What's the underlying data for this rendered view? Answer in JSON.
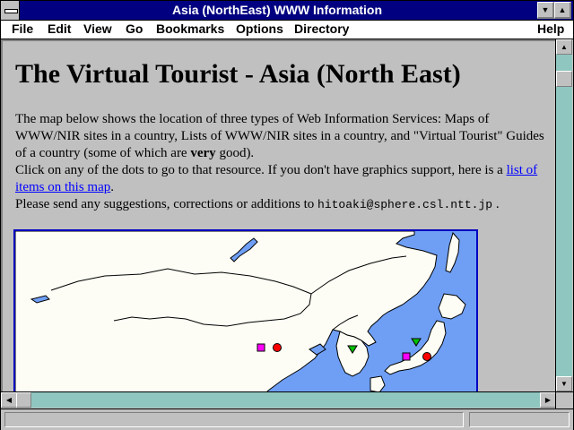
{
  "window": {
    "title": "Asia (NorthEast) WWW Information"
  },
  "menubar": {
    "file": "File",
    "edit": "Edit",
    "view": "View",
    "go": "Go",
    "bookmarks": "Bookmarks",
    "options": "Options",
    "directory": "Directory",
    "help": "Help"
  },
  "page": {
    "heading": "The Virtual Tourist - Asia (North East)",
    "intro_1": "The map below shows the location of three types of Web Information Services: Maps of WWW/NIR sites in a country, Lists of WWW/NIR sites in a country, and \"Virtual Tourist\" Guides of a country (some of which are ",
    "intro_bold": "very",
    "intro_2": " good).",
    "click_text": "Click on any of the dots to go to that resource. If you don't have graphics support, here is a ",
    "list_link": "list of items on this map",
    "list_after": ".",
    "send_text": "Please send any suggestions, corrections or additions to ",
    "email": "hitoaki@sphere.csl.ntt.jp",
    "send_after": " ."
  },
  "map": {
    "colors": {
      "sea": "#6f9ff5",
      "land": "#fdfdf5",
      "frame": "#0000c0",
      "map_marker": "#ff00ff",
      "list_marker": "#ff0000",
      "guide_marker": "#00c000"
    }
  }
}
